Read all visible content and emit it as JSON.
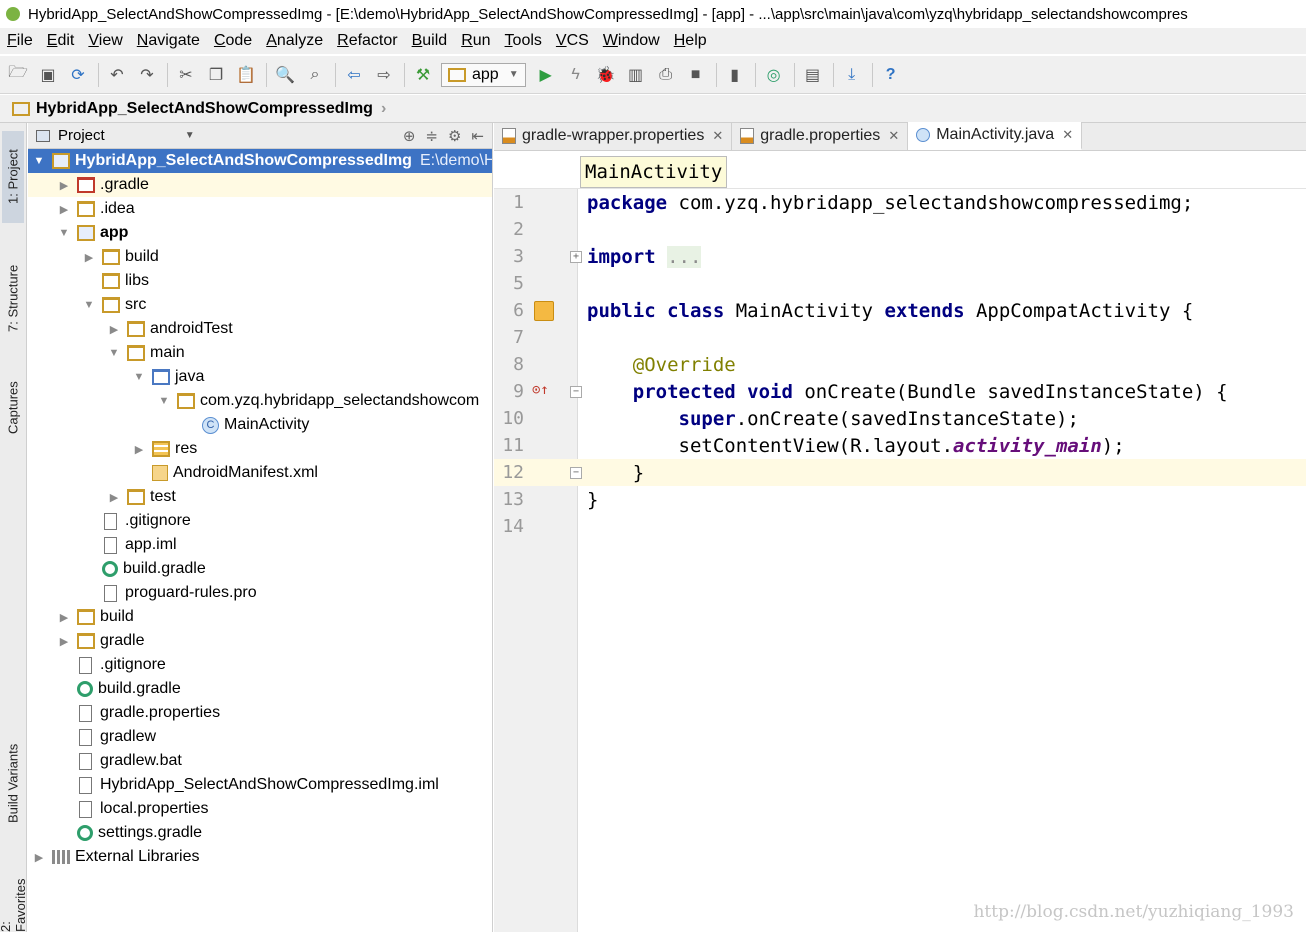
{
  "window": {
    "title": "HybridApp_SelectAndShowCompressedImg - [E:\\demo\\HybridApp_SelectAndShowCompressedImg] - [app] - ...\\app\\src\\main\\java\\com\\yzq\\hybridapp_selectandshowcompres"
  },
  "menu": [
    "File",
    "Edit",
    "View",
    "Navigate",
    "Code",
    "Analyze",
    "Refactor",
    "Build",
    "Run",
    "Tools",
    "VCS",
    "Window",
    "Help"
  ],
  "toolbar": {
    "run_config": "app"
  },
  "navbar": {
    "crumb": "HybridApp_SelectAndShowCompressedImg"
  },
  "side_tabs": {
    "project": "1: Project",
    "structure": "7: Structure",
    "captures": "Captures",
    "build_variants": "Build Variants",
    "favorites": "2: Favorites"
  },
  "project_panel": {
    "header": "Project",
    "tree": [
      {
        "label": "HybridApp_SelectAndShowCompressedImg",
        "path": "E:\\demo\\H",
        "depth": 0,
        "toggle": "down",
        "icon": "module"
      },
      {
        "label": ".gradle",
        "depth": 1,
        "toggle": "right",
        "icon": "folder-red"
      },
      {
        "label": ".idea",
        "depth": 1,
        "toggle": "right",
        "icon": "folder"
      },
      {
        "label": "app",
        "depth": 1,
        "toggle": "down",
        "icon": "module",
        "bold": true
      },
      {
        "label": "build",
        "depth": 2,
        "toggle": "right",
        "icon": "folder"
      },
      {
        "label": "libs",
        "depth": 2,
        "toggle": "",
        "icon": "folder"
      },
      {
        "label": "src",
        "depth": 2,
        "toggle": "down",
        "icon": "folder"
      },
      {
        "label": "androidTest",
        "depth": 3,
        "toggle": "right",
        "icon": "folder"
      },
      {
        "label": "main",
        "depth": 3,
        "toggle": "down",
        "icon": "folder"
      },
      {
        "label": "java",
        "depth": 4,
        "toggle": "down",
        "icon": "folder-blue"
      },
      {
        "label": "com.yzq.hybridapp_selectandshowcom",
        "depth": 5,
        "toggle": "down",
        "icon": "folder"
      },
      {
        "label": "MainActivity",
        "depth": 6,
        "toggle": "",
        "icon": "class"
      },
      {
        "label": "res",
        "depth": 4,
        "toggle": "right",
        "icon": "res"
      },
      {
        "label": "AndroidManifest.xml",
        "depth": 4,
        "toggle": "",
        "icon": "xml"
      },
      {
        "label": "test",
        "depth": 3,
        "toggle": "right",
        "icon": "folder"
      },
      {
        "label": ".gitignore",
        "depth": 2,
        "toggle": "",
        "icon": "file"
      },
      {
        "label": "app.iml",
        "depth": 2,
        "toggle": "",
        "icon": "file"
      },
      {
        "label": "build.gradle",
        "depth": 2,
        "toggle": "",
        "icon": "gradle"
      },
      {
        "label": "proguard-rules.pro",
        "depth": 2,
        "toggle": "",
        "icon": "file"
      },
      {
        "label": "build",
        "depth": 1,
        "toggle": "right",
        "icon": "folder"
      },
      {
        "label": "gradle",
        "depth": 1,
        "toggle": "right",
        "icon": "folder"
      },
      {
        "label": ".gitignore",
        "depth": 1,
        "toggle": "",
        "icon": "file"
      },
      {
        "label": "build.gradle",
        "depth": 1,
        "toggle": "",
        "icon": "gradle"
      },
      {
        "label": "gradle.properties",
        "depth": 1,
        "toggle": "",
        "icon": "file"
      },
      {
        "label": "gradlew",
        "depth": 1,
        "toggle": "",
        "icon": "file"
      },
      {
        "label": "gradlew.bat",
        "depth": 1,
        "toggle": "",
        "icon": "file"
      },
      {
        "label": "HybridApp_SelectAndShowCompressedImg.iml",
        "depth": 1,
        "toggle": "",
        "icon": "file"
      },
      {
        "label": "local.properties",
        "depth": 1,
        "toggle": "",
        "icon": "file"
      },
      {
        "label": "settings.gradle",
        "depth": 1,
        "toggle": "",
        "icon": "gradle"
      },
      {
        "label": "External Libraries",
        "depth": 0,
        "toggle": "right",
        "icon": "lib"
      }
    ]
  },
  "editor": {
    "tabs": [
      {
        "label": "gradle-wrapper.properties",
        "active": false,
        "icon": "properties-icon"
      },
      {
        "label": "gradle.properties",
        "active": false,
        "icon": "properties-icon"
      },
      {
        "label": "MainActivity.java",
        "active": true,
        "icon": "class-icon"
      }
    ],
    "breadcrumb_tip": "MainActivity",
    "lines": [
      {
        "n": "1",
        "html": "<span class='kw'>package</span> com.yzq.hybridapp_selectandshowcompressedimg;"
      },
      {
        "n": "2",
        "html": ""
      },
      {
        "n": "3",
        "html": "<span class='kw'>import</span> <span class='fold'>...</span>"
      },
      {
        "n": "5",
        "html": ""
      },
      {
        "n": "6",
        "html": "<span class='kw'>public class</span> MainActivity <span class='kw'>extends</span> AppCompatActivity {"
      },
      {
        "n": "7",
        "html": ""
      },
      {
        "n": "8",
        "html": "    <span class='ann'>@Override</span>"
      },
      {
        "n": "9",
        "html": "    <span class='kw'>protected void</span> onCreate(Bundle savedInstanceState) {"
      },
      {
        "n": "10",
        "html": "        <span class='kw'>super</span>.onCreate(savedInstanceState);"
      },
      {
        "n": "11",
        "html": "        setContentView(R.layout.<span class='it'>activity_main</span>);"
      },
      {
        "n": "12",
        "html": "    }"
      },
      {
        "n": "13",
        "html": "}"
      },
      {
        "n": "14",
        "html": ""
      }
    ]
  },
  "watermark": "http://blog.csdn.net/yuzhiqiang_1993"
}
